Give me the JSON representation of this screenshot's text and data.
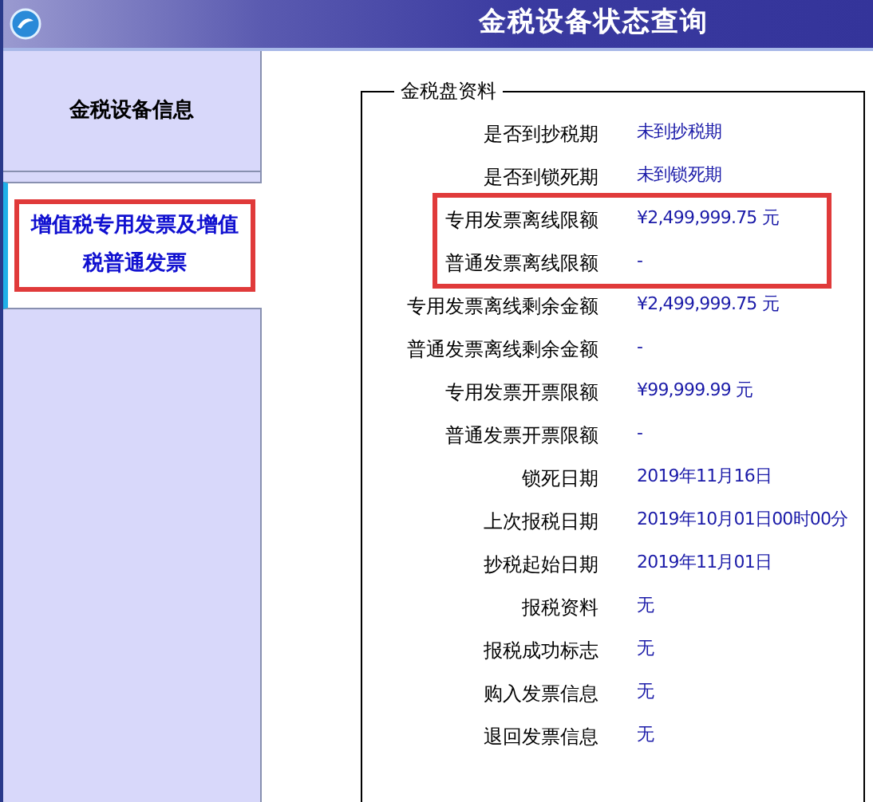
{
  "window": {
    "title": "金税设备状态查询"
  },
  "sidebar": {
    "items": [
      {
        "label": "金税设备信息",
        "selected": false,
        "highlighted": false
      },
      {
        "label": "增值税专用发票及增值税普通发票",
        "selected": true,
        "highlighted": true
      }
    ]
  },
  "panel": {
    "legend": "金税盘资料",
    "row_groups": [
      {
        "highlighted": false,
        "rows": [
          {
            "label": "是否到抄税期",
            "value": "未到抄税期"
          },
          {
            "label": "是否到锁死期",
            "value": "未到锁死期"
          }
        ]
      },
      {
        "highlighted": true,
        "rows": [
          {
            "label": "专用发票离线限额",
            "value": "¥2,499,999.75 元"
          },
          {
            "label": "普通发票离线限额",
            "value": "-"
          }
        ]
      },
      {
        "highlighted": false,
        "rows": [
          {
            "label": "专用发票离线剩余金额",
            "value": "¥2,499,999.75 元"
          },
          {
            "label": "普通发票离线剩余金额",
            "value": "-"
          },
          {
            "label": "专用发票开票限额",
            "value": "¥99,999.99 元"
          },
          {
            "label": "普通发票开票限额",
            "value": "-"
          },
          {
            "label": "锁死日期",
            "value": "2019年11月16日"
          },
          {
            "label": "上次报税日期",
            "value": "2019年10月01日00时00分"
          },
          {
            "label": "抄税起始日期",
            "value": "2019年11月01日"
          },
          {
            "label": "报税资料",
            "value": "无"
          },
          {
            "label": "报税成功标志",
            "value": "无"
          },
          {
            "label": "购入发票信息",
            "value": "无"
          },
          {
            "label": "退回发票信息",
            "value": "无"
          }
        ]
      }
    ]
  }
}
